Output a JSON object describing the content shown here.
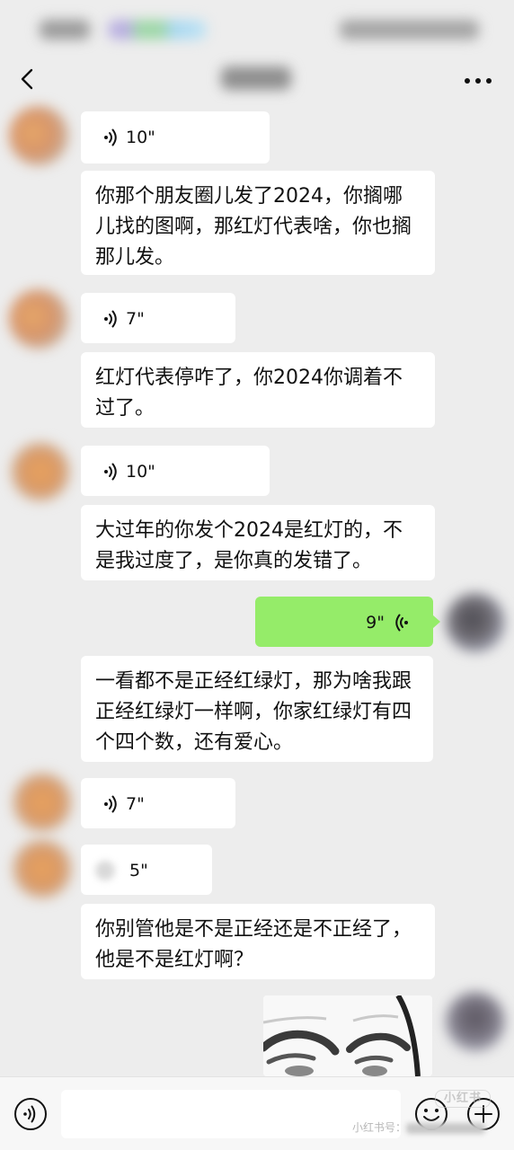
{
  "status_bar": {
    "time_blurred": "",
    "right_blurred": ""
  },
  "header": {
    "title_blurred": "",
    "back_icon": "chevron-left-icon",
    "more_icon": "more-dots-icon"
  },
  "messages": [
    {
      "side": "left",
      "type": "voice",
      "duration": "10\""
    },
    {
      "side": "left",
      "type": "text",
      "text": "你那个朋友圈儿发了2024，你搁哪儿找的图啊，那红灯代表啥，你也搁那儿发。"
    },
    {
      "side": "left",
      "type": "voice",
      "duration": "7\""
    },
    {
      "side": "left",
      "type": "text",
      "text": "红灯代表停咋了，你2024你调着不过了。"
    },
    {
      "side": "left",
      "type": "voice",
      "duration": "10\""
    },
    {
      "side": "left",
      "type": "text",
      "text": "大过年的你发个2024是红灯的，不是我过度了，是你真的发错了。"
    },
    {
      "side": "right",
      "type": "voice",
      "duration": "9\""
    },
    {
      "side": "left",
      "type": "text",
      "text": "一看都不是正经红绿灯，那为啥我跟正经红绿灯一样啊，你家红绿灯有四个四个数，还有爱心。"
    },
    {
      "side": "left",
      "type": "voice",
      "duration": "7\""
    },
    {
      "side": "left",
      "type": "voice",
      "duration": "5\""
    },
    {
      "side": "left",
      "type": "text",
      "text": "你别管他是不是正经还是不正经了，他是不是红灯啊？"
    },
    {
      "side": "right",
      "type": "image",
      "description_icon": "sticker-image"
    }
  ],
  "input_bar": {
    "voice_icon": "voice-input-icon",
    "emoji_icon": "emoji-icon",
    "plus_icon": "plus-circle-icon",
    "input_value": ""
  },
  "watermark": {
    "logo": "小红书",
    "text": "小红书号："
  },
  "colors": {
    "background": "#ededed",
    "incoming_bubble": "#ffffff",
    "outgoing_bubble": "#95ec69"
  }
}
